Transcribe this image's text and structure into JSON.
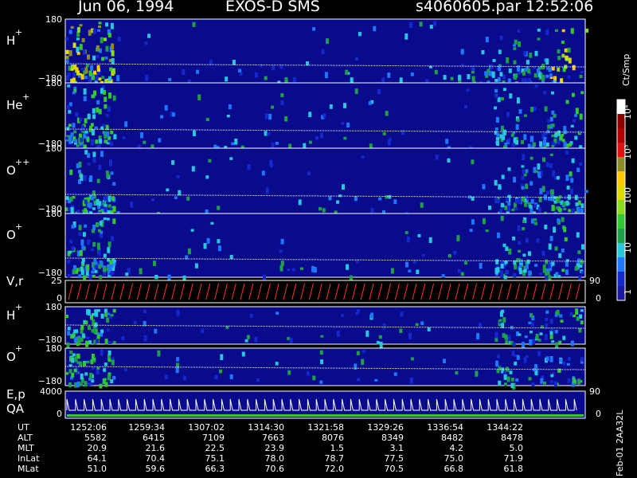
{
  "header": {
    "date": "Jun 06, 1994",
    "title": "EXOS-D SMS",
    "file": "s4060605.par",
    "time": "12:52:06"
  },
  "side_label": "Feb-01 2AA32L",
  "colorbar": {
    "unit_label": "Ct/Smp",
    "tick_labels": [
      "10⁴",
      "10³",
      "100",
      "10",
      "1"
    ],
    "colors": [
      "#1a1aa0",
      "#1428cd",
      "#1e78ff",
      "#28c8dc",
      "#1ea046",
      "#32c832",
      "#8cdc1e",
      "#dcdc00",
      "#ffc800",
      "#8c8c28",
      "#dc1414",
      "#b40000",
      "#8c0000",
      "#ffffff"
    ]
  },
  "chart_data": {
    "type": "heatmap",
    "panels": [
      {
        "label": "H",
        "sup": "+",
        "ymax": "180",
        "ymin": "−180"
      },
      {
        "label": "He",
        "sup": "+",
        "ymax": "180",
        "ymin": "−180"
      },
      {
        "label": "O",
        "sup": "++",
        "ymax": "180",
        "ymin": "−180"
      },
      {
        "label": "O",
        "sup": "+",
        "ymax": "180",
        "ymin": "−180"
      },
      {
        "label": "V,r",
        "sup": "",
        "ymax": "25",
        "ymin": "0",
        "right_max": "90",
        "right_min": "0"
      },
      {
        "label": "H",
        "sup": "+",
        "ymax": "180",
        "ymin": "−180"
      },
      {
        "label": "O",
        "sup": "+",
        "ymax": "180",
        "ymin": "−180"
      },
      {
        "label": "E,p",
        "label2": "QA",
        "sup": "",
        "ymax": "4000",
        "ymin": "0",
        "right_max": "90",
        "right_min": "0"
      }
    ],
    "xaxis": {
      "row_labels": [
        "UT",
        "ALT",
        "MLT",
        "InLat",
        "MLat"
      ],
      "columns": [
        {
          "UT": "1252:06",
          "ALT": "5582",
          "MLT": "20.9",
          "InLat": "64.1",
          "MLat": "51.0"
        },
        {
          "UT": "1259:34",
          "ALT": "6415",
          "MLT": "21.6",
          "InLat": "70.4",
          "MLat": "59.6"
        },
        {
          "UT": "1307:02",
          "ALT": "7109",
          "MLT": "22.5",
          "InLat": "75.1",
          "MLat": "66.3"
        },
        {
          "UT": "1314:30",
          "ALT": "7663",
          "MLT": "23.9",
          "InLat": "78.0",
          "MLat": "70.6"
        },
        {
          "UT": "1321:58",
          "ALT": "8076",
          "MLT": "1.5",
          "InLat": "78.7",
          "MLat": "72.0"
        },
        {
          "UT": "1329:26",
          "ALT": "8349",
          "MLT": "3.1",
          "InLat": "77.5",
          "MLat": "70.5"
        },
        {
          "UT": "1336:54",
          "ALT": "8482",
          "MLT": "4.2",
          "InLat": "75.0",
          "MLat": "66.8"
        },
        {
          "UT": "1344:22",
          "ALT": "8478",
          "MLT": "5.0",
          "InLat": "71.9",
          "MLat": "61.8"
        }
      ]
    }
  }
}
